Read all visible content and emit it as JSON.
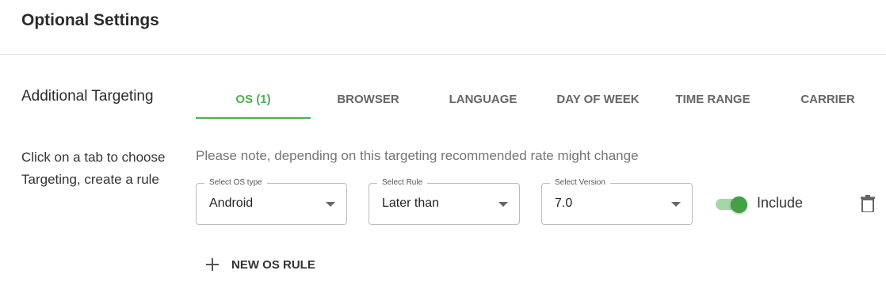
{
  "header": {
    "title": "Optional Settings"
  },
  "section": {
    "label": "Additional Targeting"
  },
  "tabs": [
    {
      "label": "OS (1)",
      "active": true
    },
    {
      "label": "BROWSER",
      "active": false
    },
    {
      "label": "LANGUAGE",
      "active": false
    },
    {
      "label": "DAY OF WEEK",
      "active": false
    },
    {
      "label": "TIME RANGE",
      "active": false
    },
    {
      "label": "CARRIER",
      "active": false
    }
  ],
  "help_text": "Click on a tab to choose Targeting, create a rule",
  "note_text": "Please note, depending on this targeting recommended rate might change",
  "rule": {
    "os_type": {
      "label": "Select OS type",
      "value": "Android"
    },
    "rule": {
      "label": "Select Rule",
      "value": "Later than"
    },
    "version": {
      "label": "Select Version",
      "value": "7.0"
    },
    "include": {
      "label": "Include",
      "on": true
    }
  },
  "new_rule": {
    "label": "NEW OS RULE"
  },
  "colors": {
    "accent": "#4caf50",
    "toggle_thumb": "#43a047",
    "toggle_track": "#a5d6a7"
  },
  "icons": {
    "dropdown": "caret-down-icon",
    "delete": "trash-icon",
    "add": "plus-icon"
  }
}
